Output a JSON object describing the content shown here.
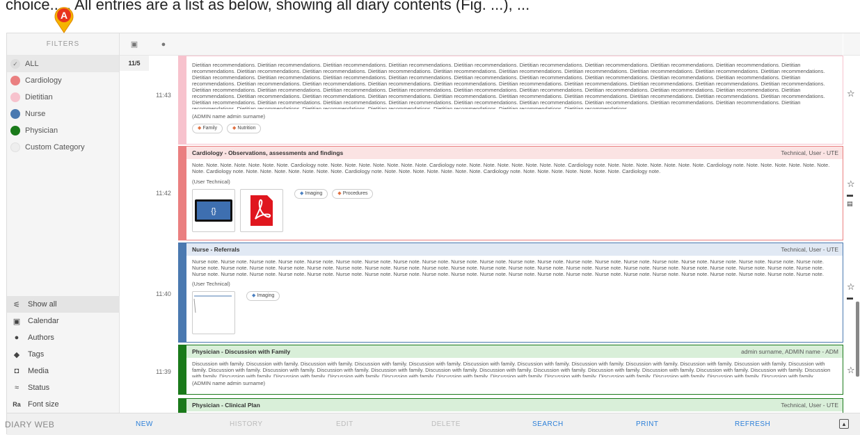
{
  "caption": "choice... . All entries are a list as below, showing all diary contents (Fig. ...), ...",
  "marker": {
    "label": "A"
  },
  "filters": {
    "header": "FILTERS",
    "categories": [
      {
        "label": "ALL",
        "color": "#dddddd",
        "active": true
      },
      {
        "label": "Cardiology",
        "color": "#ea7f80"
      },
      {
        "label": "Dietitian",
        "color": "#f7c2cd"
      },
      {
        "label": "Nurse",
        "color": "#4a79b0"
      },
      {
        "label": "Physician",
        "color": "#1a7a1a"
      },
      {
        "label": "Custom Category",
        "color": "#eeeeee"
      }
    ],
    "menu": [
      {
        "label": "Show all",
        "icon": "filter-lines-icon",
        "glyph": "⚟",
        "active": true
      },
      {
        "label": "Calendar",
        "icon": "calendar-icon",
        "glyph": "▣"
      },
      {
        "label": "Authors",
        "icon": "person-icon",
        "glyph": "●"
      },
      {
        "label": "Tags",
        "icon": "tag-icon",
        "glyph": "◆"
      },
      {
        "label": "Media",
        "icon": "media-icon",
        "glyph": "◘"
      },
      {
        "label": "Status",
        "icon": "status-icon",
        "glyph": "≈"
      },
      {
        "label": "Font size",
        "icon": "font-size-icon",
        "glyph": "Ra"
      }
    ]
  },
  "timecol": {
    "date": "11/5",
    "times": [
      "11:43",
      "11:42",
      "11:40",
      "11:39"
    ]
  },
  "entries": [
    {
      "title": "",
      "author": "",
      "body": "Dietitian recommendations. Dietitian recommendations. Dietitian recommendations. Dietitian recommendations. Dietitian recommendations. Dietitian recommendations. Dietitian recommendations. Dietitian recommendations. Dietitian recommendations. Dietitian recommendations. Dietitian recommendations. Dietitian recommendations. Dietitian recommendations. Dietitian recommendations. Dietitian recommendations. Dietitian recommendations. Dietitian recommendations. Dietitian recommendations. Dietitian recommendations. Dietitian recommendations. Dietitian recommendations. Dietitian recommendations. Dietitian recommendations. Dietitian recommendations. Dietitian recommendations. Dietitian recommendations. Dietitian recommendations. Dietitian recommendations. Dietitian recommendations. Dietitian recommendations. Dietitian recommendations. Dietitian recommendations. Dietitian recommendations. Dietitian recommendations. Dietitian recommendations. Dietitian recommendations. Dietitian recommendations. Dietitian recommendations. Dietitian recommendations. Dietitian recommendations. Dietitian recommendations. Dietitian recommendations. Dietitian recommendations. Dietitian recommendations. Dietitian recommendations. Dietitian recommendations. Dietitian recommendations. Dietitian recommendations. Dietitian recommendations. Dietitian recommendations. Dietitian recommendations. Dietitian recommendations. Dietitian recommendations. Dietitian recommendations. Dietitian recommendations. Dietitian recommendations. Dietitian recommendations. Dietitian recommendations. Dietitian recommendations. Dietitian recommendations. Dietitian recommendations. Dietitian recommendations. Dietitian recommendations. Dietitian recommendations. Dietitian recommendations. Dietitian recommendations. Dietitian recommendations. Dietitian recommendations. Dietitian recommendations. Dietitian recommendations. Dietitian recommendations. Dietitian recommendations. Dietitian recommendations.",
      "user": "(ADMIN name admin surname)",
      "tags": [
        "Family",
        "Nutrition"
      ],
      "color": "#f7c2cd"
    },
    {
      "title": "Cardiology - Observations, assessments and findings",
      "author": "Technical, User - UTE",
      "body": "Note. Note. Note. Note. Note. Note. Note. Cardiology note. Note. Note. Note. Note. Note. Note. Note. Cardiology note. Note. Note. Note. Note. Note. Note. Note. Cardiology note. Note. Note. Note. Note. Note. Note. Note. Cardiology note. Note. Note. Note. Note. Note. Note. Note. Cardiology note. Note. Note. Note. Note. Note. Note. Note. Cardiology note. Note. Note. Note. Note. Note. Note. Note. Cardiology note. Note. Note. Note. Note. Note. Note. Note. Cardiology note.",
      "user": "(User Technical)",
      "tags": [
        "Imaging",
        "Procedures"
      ],
      "color": "#ea7f80"
    },
    {
      "title": "Nurse - Referrals",
      "author": "Technical, User - UTE",
      "body": "Nurse note. Nurse note. Nurse note. Nurse note. Nurse note. Nurse note. Nurse note. Nurse note. Nurse note. Nurse note. Nurse note. Nurse note. Nurse note. Nurse note. Nurse note. Nurse note. Nurse note. Nurse note. Nurse note. Nurse note. Nurse note. Nurse note. Nurse note. Nurse note. Nurse note. Nurse note. Nurse note. Nurse note. Nurse note. Nurse note. Nurse note. Nurse note. Nurse note. Nurse note. Nurse note. Nurse note. Nurse note. Nurse note. Nurse note. Nurse note. Nurse note. Nurse note. Nurse note. Nurse note. Nurse note. Nurse note. Nurse note. Nurse note. Nurse note. Nurse note. Nurse note. Nurse note. Nurse note. Nurse note. Nurse note. Nurse note. Nurse note. Nurse note. Nurse note. Nurse note. Nurse note. Nurse note. Nurse note. Nurse note. Nurse note. Nurse note. Nurse note. Nurse note. Nurse note. Nurse note. Nurse note.",
      "user": "(User Technical)",
      "tags": [
        "Imaging"
      ],
      "color": "#4a79b0"
    },
    {
      "title": "Physician - Discussion with Family",
      "author": "admin surname, ADMIN name - ADM",
      "body": "Discussion with family. Discussion with family. Discussion with family. Discussion with family. Discussion with family. Discussion with family. Discussion with family. Discussion with family. Discussion with family. Discussion with family. Discussion with family. Discussion with family. Discussion with family. Discussion with family. Discussion with family. Discussion with family. Discussion with family. Discussion with family. Discussion with family. Discussion with family. Discussion with family. Discussion with family. Discussion with family. Discussion with family. Discussion with family. Discussion with family. Discussion with family. Discussion with family. Discussion with family. Discussion with family. Discussion with family. Discussion with family. Discussion with family. Discussion with family. Discussion with family. Discussion with family.",
      "user": "(ADMIN name admin surname)",
      "color": "#1a7a1a"
    },
    {
      "title": "Physician - Clinical Plan",
      "author": "Technical, User - UTE",
      "color": "#1a7a1a"
    }
  ],
  "toolbar": {
    "brand": "DIARY WEB",
    "new": "NEW",
    "history": "HISTORY",
    "edit": "EDIT",
    "delete": "DELETE",
    "search": "SEARCH",
    "print": "PRINT",
    "refresh": "REFRESH"
  }
}
